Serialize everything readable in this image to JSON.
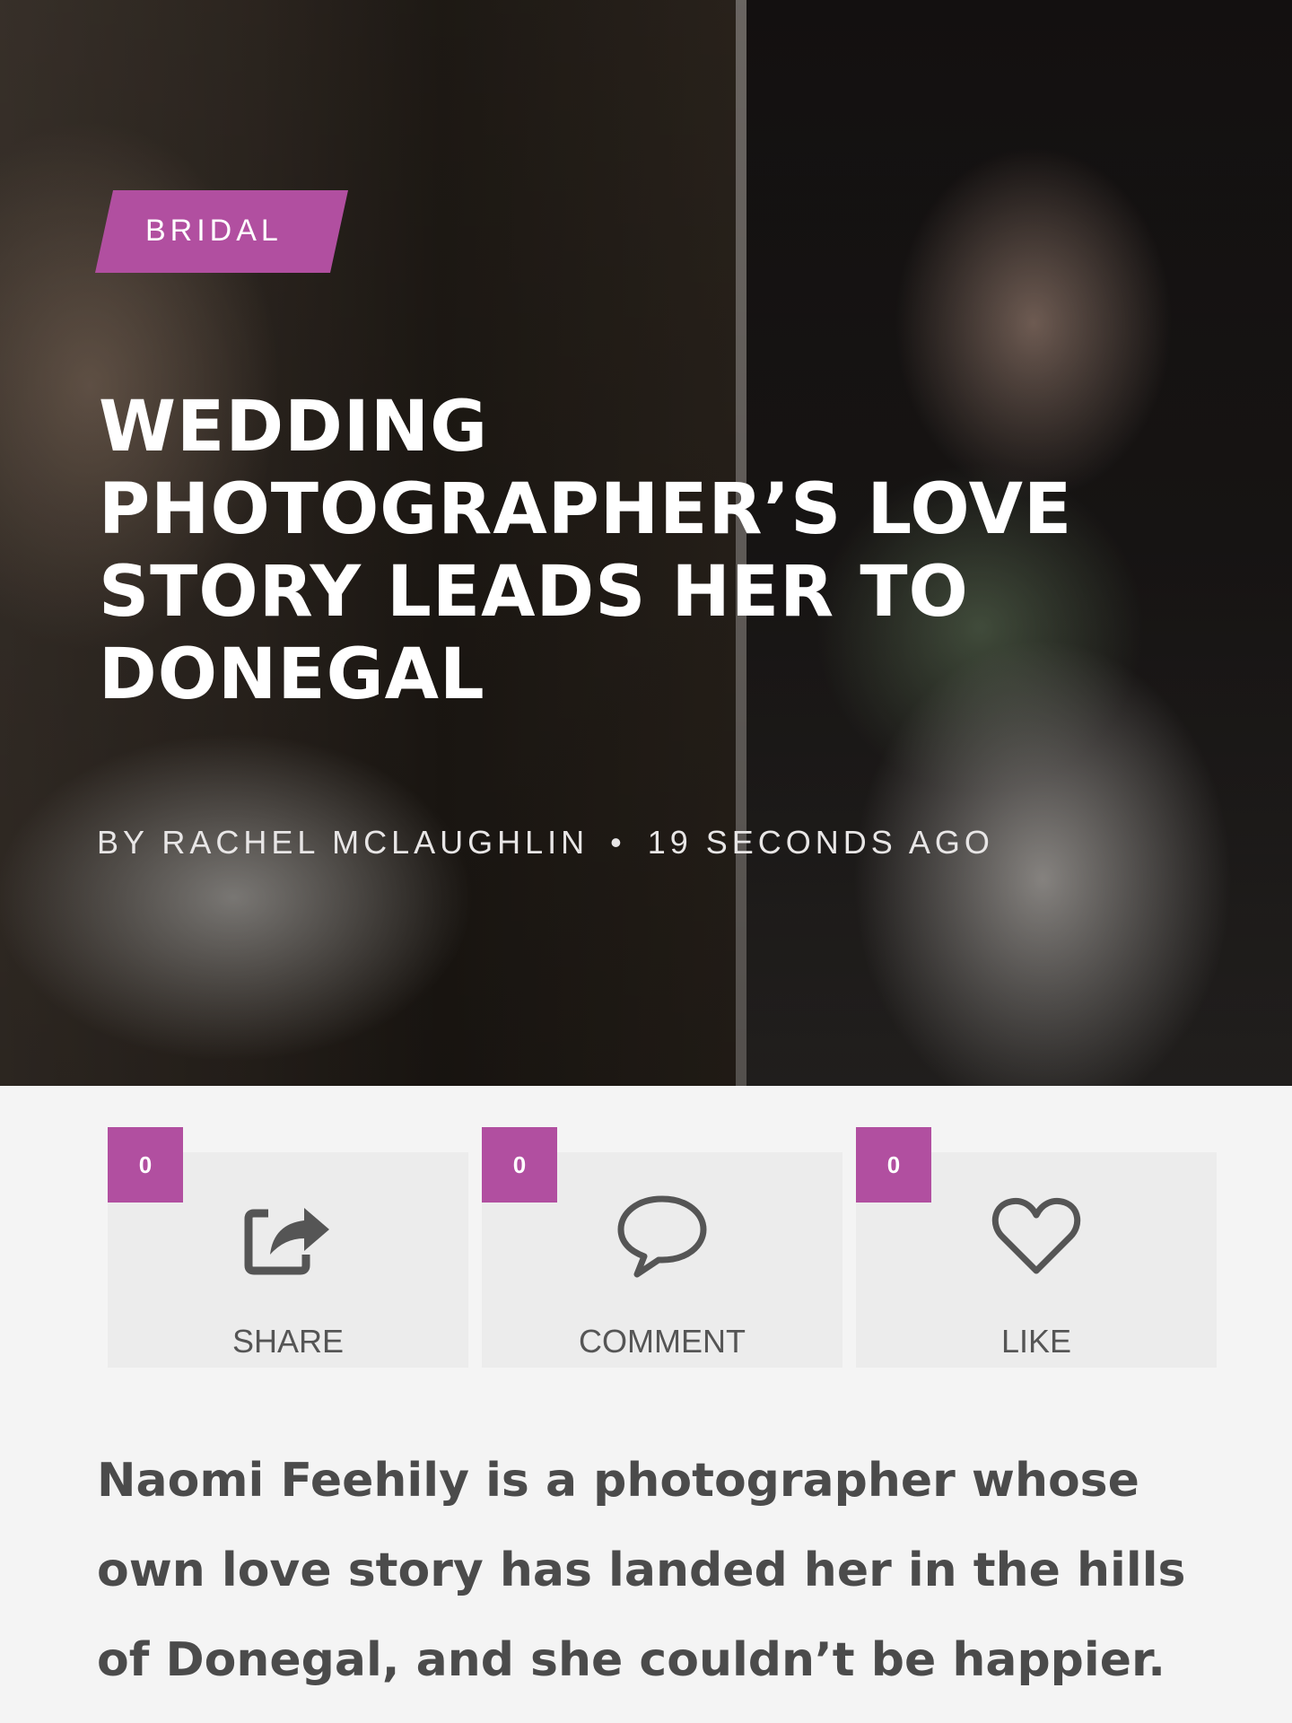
{
  "hero": {
    "category": "BRIDAL",
    "title": "WEDDING PHOTOGRAPHER’S LOVE STORY LEADS HER TO DONEGAL",
    "author": "BY RACHEL MCLAUGHLIN",
    "separator": "•",
    "time": "19 SECONDS AGO"
  },
  "actions": [
    {
      "label": "SHARE",
      "count": "0",
      "icon": "share-icon"
    },
    {
      "label": "COMMENT",
      "count": "0",
      "icon": "comment-icon"
    },
    {
      "label": "LIKE",
      "count": "0",
      "icon": "heart-icon"
    }
  ],
  "article": {
    "lead": "Naomi Feehily is a photographer whose own love story has landed her in the hills of Donegal, and she couldn’t be happier."
  },
  "colors": {
    "accent": "#b14fa0",
    "text": "#4b4b4b"
  }
}
